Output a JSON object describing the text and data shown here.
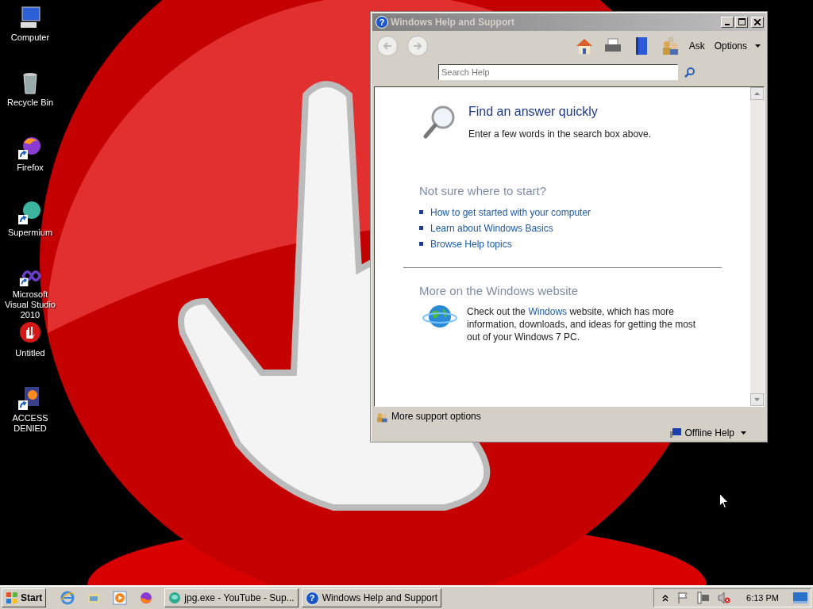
{
  "desktop_icons": [
    {
      "label": "Computer",
      "kind": "computer",
      "shortcut": false
    },
    {
      "label": "Recycle Bin",
      "kind": "recycle",
      "shortcut": false
    },
    {
      "label": "Firefox",
      "kind": "firefox",
      "shortcut": true
    },
    {
      "label": "Supermium",
      "kind": "supermium",
      "shortcut": true
    },
    {
      "label": "Microsoft Visual Studio 2010",
      "kind": "vs",
      "shortcut": true
    },
    {
      "label": "Untitled",
      "kind": "stop",
      "shortcut": false
    },
    {
      "label": "ACCESS DENIED",
      "kind": "file",
      "shortcut": true
    }
  ],
  "window": {
    "icon_glyph": "?",
    "title": "Windows Help and Support",
    "active": false,
    "toolbar": {
      "ask": "Ask",
      "options": "Options"
    },
    "search": {
      "placeholder": "Search Help"
    },
    "content": {
      "heading": "Find an answer quickly",
      "subtext": "Enter a few words in the search box above.",
      "section_title": "Not sure where to start?",
      "links": [
        "How to get started with your computer",
        "Learn about Windows Basics",
        "Browse Help topics"
      ],
      "website_title": "More on the Windows website",
      "website_before": "Check out the ",
      "website_link": "Windows",
      "website_after": " website, which has more information, downloads, and ideas for getting the most out of your Windows 7 PC."
    },
    "footer": {
      "support": "More support options",
      "offline": "Offline Help"
    }
  },
  "taskbar": {
    "start": "Start",
    "tasks": [
      {
        "label": "jpg.exe - YouTube - Sup...",
        "kind": "browser",
        "selected": false
      },
      {
        "label": "Windows Help and Support",
        "kind": "help",
        "icon_glyph": "?",
        "selected": false
      }
    ],
    "clock": "6:13 PM"
  }
}
